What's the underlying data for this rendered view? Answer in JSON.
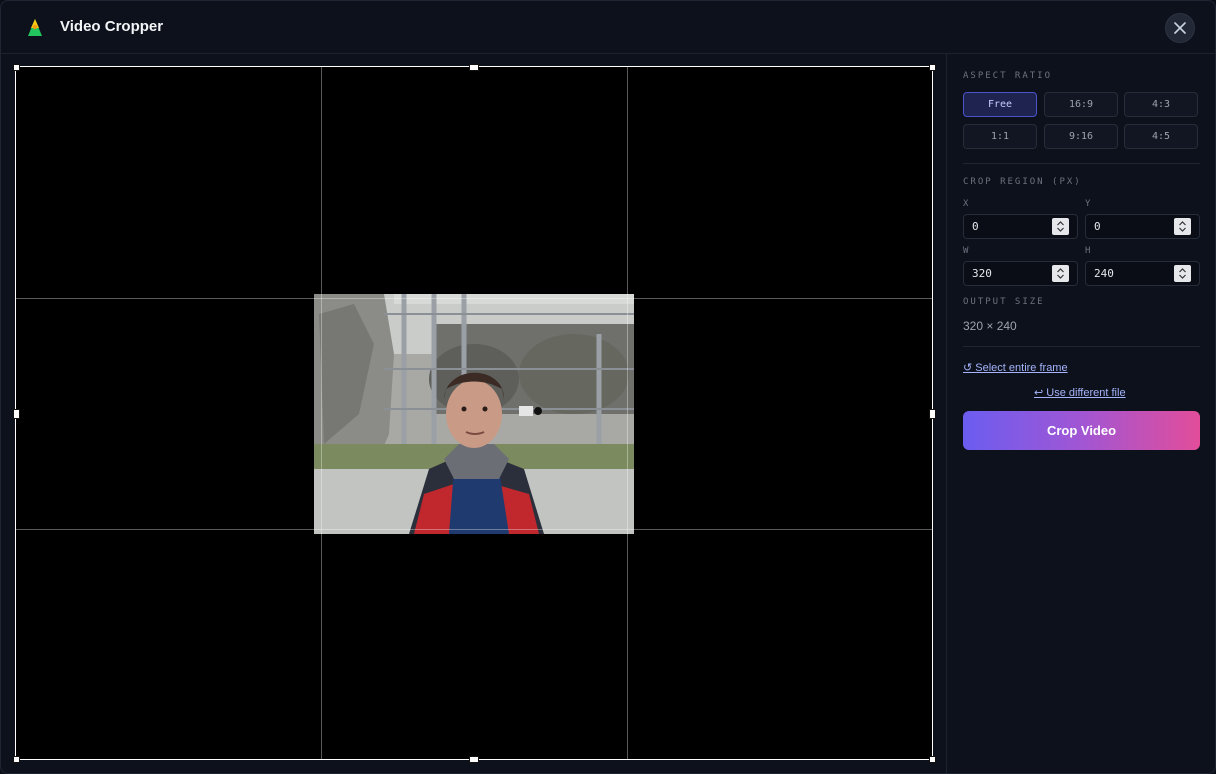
{
  "window": {
    "title": "Video Cropper",
    "app_icon": "app-logo-icon",
    "close_icon": "close-icon"
  },
  "aspect_ratio": {
    "label": "ASPECT RATIO",
    "options": [
      "Free",
      "16:9",
      "4:3",
      "1:1",
      "9:16",
      "4:5"
    ],
    "selected": "Free"
  },
  "crop_region": {
    "label": "CROP REGION (PX)",
    "x_label": "X",
    "x_value": "0",
    "y_label": "Y",
    "y_value": "0",
    "w_label": "W",
    "w_value": "320",
    "h_label": "H",
    "h_value": "240"
  },
  "output_size": {
    "label": "OUTPUT SIZE",
    "value": "320 × 240"
  },
  "links": {
    "select_entire_frame": "↺ Select entire frame",
    "use_different_file": "↩ Use different file"
  },
  "actions": {
    "crop_label": "Crop Video"
  },
  "colors": {
    "accent": "#6b5df0",
    "accent_end": "#e24d9a",
    "active_ratio": "#1f2350"
  }
}
